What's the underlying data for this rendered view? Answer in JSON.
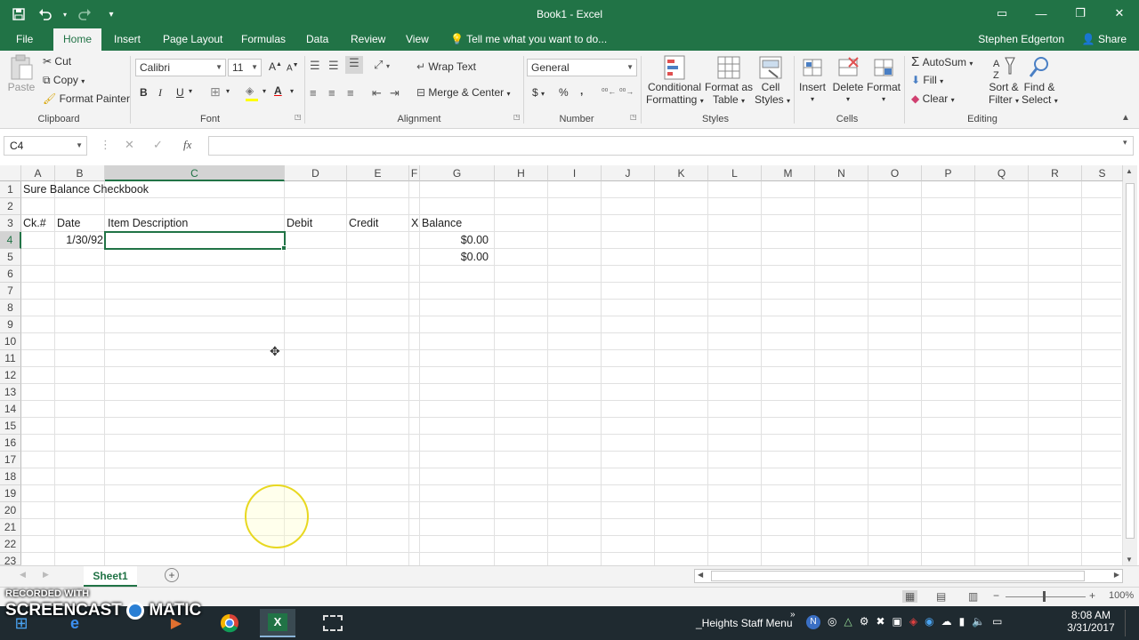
{
  "window": {
    "title": "Book1 - Excel"
  },
  "qat": {
    "save": "save-icon",
    "undo": "undo-icon",
    "redo": "redo-icon"
  },
  "tabs": [
    "File",
    "Home",
    "Insert",
    "Page Layout",
    "Formulas",
    "Data",
    "Review",
    "View"
  ],
  "tell_me": "Tell me what you want to do...",
  "user_name": "Stephen Edgerton",
  "share_label": "Share",
  "ribbon": {
    "clipboard": {
      "label": "Clipboard",
      "paste": "Paste",
      "cut": "Cut",
      "copy": "Copy",
      "format_painter": "Format Painter"
    },
    "font": {
      "label": "Font",
      "family": "Calibri",
      "size": "11",
      "bold": "B",
      "italic": "I",
      "underline": "U"
    },
    "alignment": {
      "label": "Alignment",
      "wrap": "Wrap Text",
      "merge": "Merge & Center"
    },
    "number": {
      "label": "Number",
      "format": "General",
      "currency": "$",
      "percent": "%",
      "comma": ","
    },
    "styles": {
      "label": "Styles",
      "conditional": [
        "Conditional",
        "Formatting"
      ],
      "format_table": [
        "Format as",
        "Table"
      ],
      "cell_styles": [
        "Cell",
        "Styles"
      ]
    },
    "cells": {
      "label": "Cells",
      "insert": "Insert",
      "delete": "Delete",
      "format": "Format"
    },
    "editing": {
      "label": "Editing",
      "autosum": "AutoSum",
      "fill": "Fill",
      "clear": "Clear",
      "sort": [
        "Sort &",
        "Filter"
      ],
      "find": [
        "Find &",
        "Select"
      ]
    }
  },
  "formula_bar": {
    "name_box": "C4",
    "fx": "fx",
    "value": ""
  },
  "columns": [
    "A",
    "B",
    "C",
    "D",
    "E",
    "F",
    "G",
    "H",
    "I",
    "J",
    "K",
    "L",
    "M",
    "N",
    "O",
    "P",
    "Q",
    "R",
    "S"
  ],
  "rows": [
    "1",
    "2",
    "3",
    "4",
    "5",
    "6",
    "7",
    "8",
    "9",
    "10",
    "11",
    "12",
    "13",
    "14",
    "15",
    "16",
    "17",
    "18",
    "19",
    "20",
    "21",
    "22",
    "23"
  ],
  "selected_cell": "C4",
  "cells": {
    "A1": "Sure Balance Checkbook",
    "A3": "Ck.#",
    "B3": "Date",
    "C3": "Item Description",
    "D3": "Debit",
    "E3": "Credit",
    "F3": "X",
    "G3": "Balance",
    "B4": "1/30/92",
    "G4": "$0.00",
    "G5": "$0.00"
  },
  "sheet_tab": "Sheet1",
  "status": {
    "zoom": "100%"
  },
  "taskbar": {
    "tray_label": "_Heights Staff Menu",
    "time": "8:08 AM",
    "date": "3/31/2017"
  },
  "watermark": {
    "line1": "RECORDED WITH",
    "line2": "SCREENCAST",
    "line3": "MATIC"
  },
  "colors": {
    "accent": "#217346",
    "ribbon_bg": "#f3f3f3",
    "cursor_ring": "#e8d820"
  }
}
